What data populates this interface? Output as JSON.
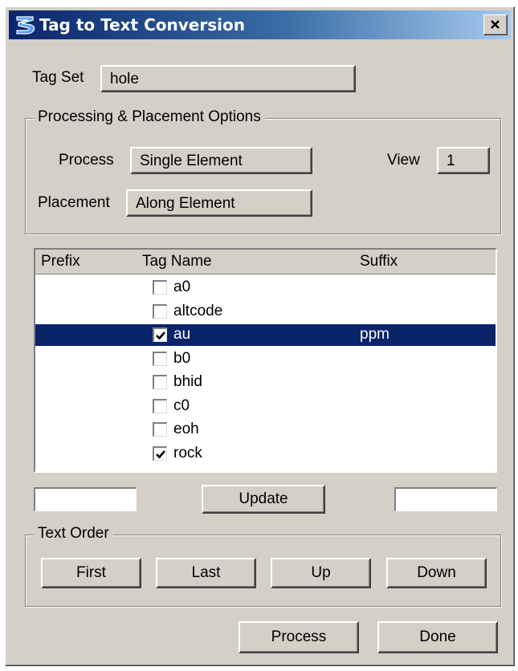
{
  "window": {
    "title": "Tag to Text Conversion",
    "close_glyph": "×"
  },
  "tagset": {
    "label": "Tag Set",
    "value": "hole"
  },
  "options": {
    "group_title": "Processing & Placement Options",
    "process_label": "Process",
    "process_value": "Single Element",
    "view_label": "View",
    "view_value": "1",
    "placement_label": "Placement",
    "placement_value": "Along Element"
  },
  "list": {
    "headers": {
      "prefix": "Prefix",
      "tag_name": "Tag Name",
      "suffix": "Suffix"
    },
    "rows": [
      {
        "prefix": "",
        "tag": "a0",
        "suffix": "",
        "checked": false,
        "selected": false
      },
      {
        "prefix": "",
        "tag": "altcode",
        "suffix": "",
        "checked": false,
        "selected": false
      },
      {
        "prefix": "",
        "tag": "au",
        "suffix": "ppm",
        "checked": true,
        "selected": true
      },
      {
        "prefix": "",
        "tag": "b0",
        "suffix": "",
        "checked": false,
        "selected": false
      },
      {
        "prefix": "",
        "tag": "bhid",
        "suffix": "",
        "checked": false,
        "selected": false
      },
      {
        "prefix": "",
        "tag": "c0",
        "suffix": "",
        "checked": false,
        "selected": false
      },
      {
        "prefix": "",
        "tag": "eoh",
        "suffix": "",
        "checked": false,
        "selected": false
      },
      {
        "prefix": "",
        "tag": "rock",
        "suffix": "",
        "checked": true,
        "selected": false
      }
    ]
  },
  "edit": {
    "prefix_value": "",
    "update_label": "Update",
    "suffix_value": ""
  },
  "text_order": {
    "title": "Text Order",
    "first": "First",
    "last": "Last",
    "up": "Up",
    "down": "Down"
  },
  "footer": {
    "process": "Process",
    "done": "Done"
  },
  "colors": {
    "face": "#d4d0c8",
    "title_start": "#0a246a",
    "title_end": "#a6caf0",
    "selection": "#0a246a",
    "app_icon": "#1e5fd8"
  },
  "icons": {
    "app": "bentley-b-icon",
    "check": "check-mark"
  }
}
